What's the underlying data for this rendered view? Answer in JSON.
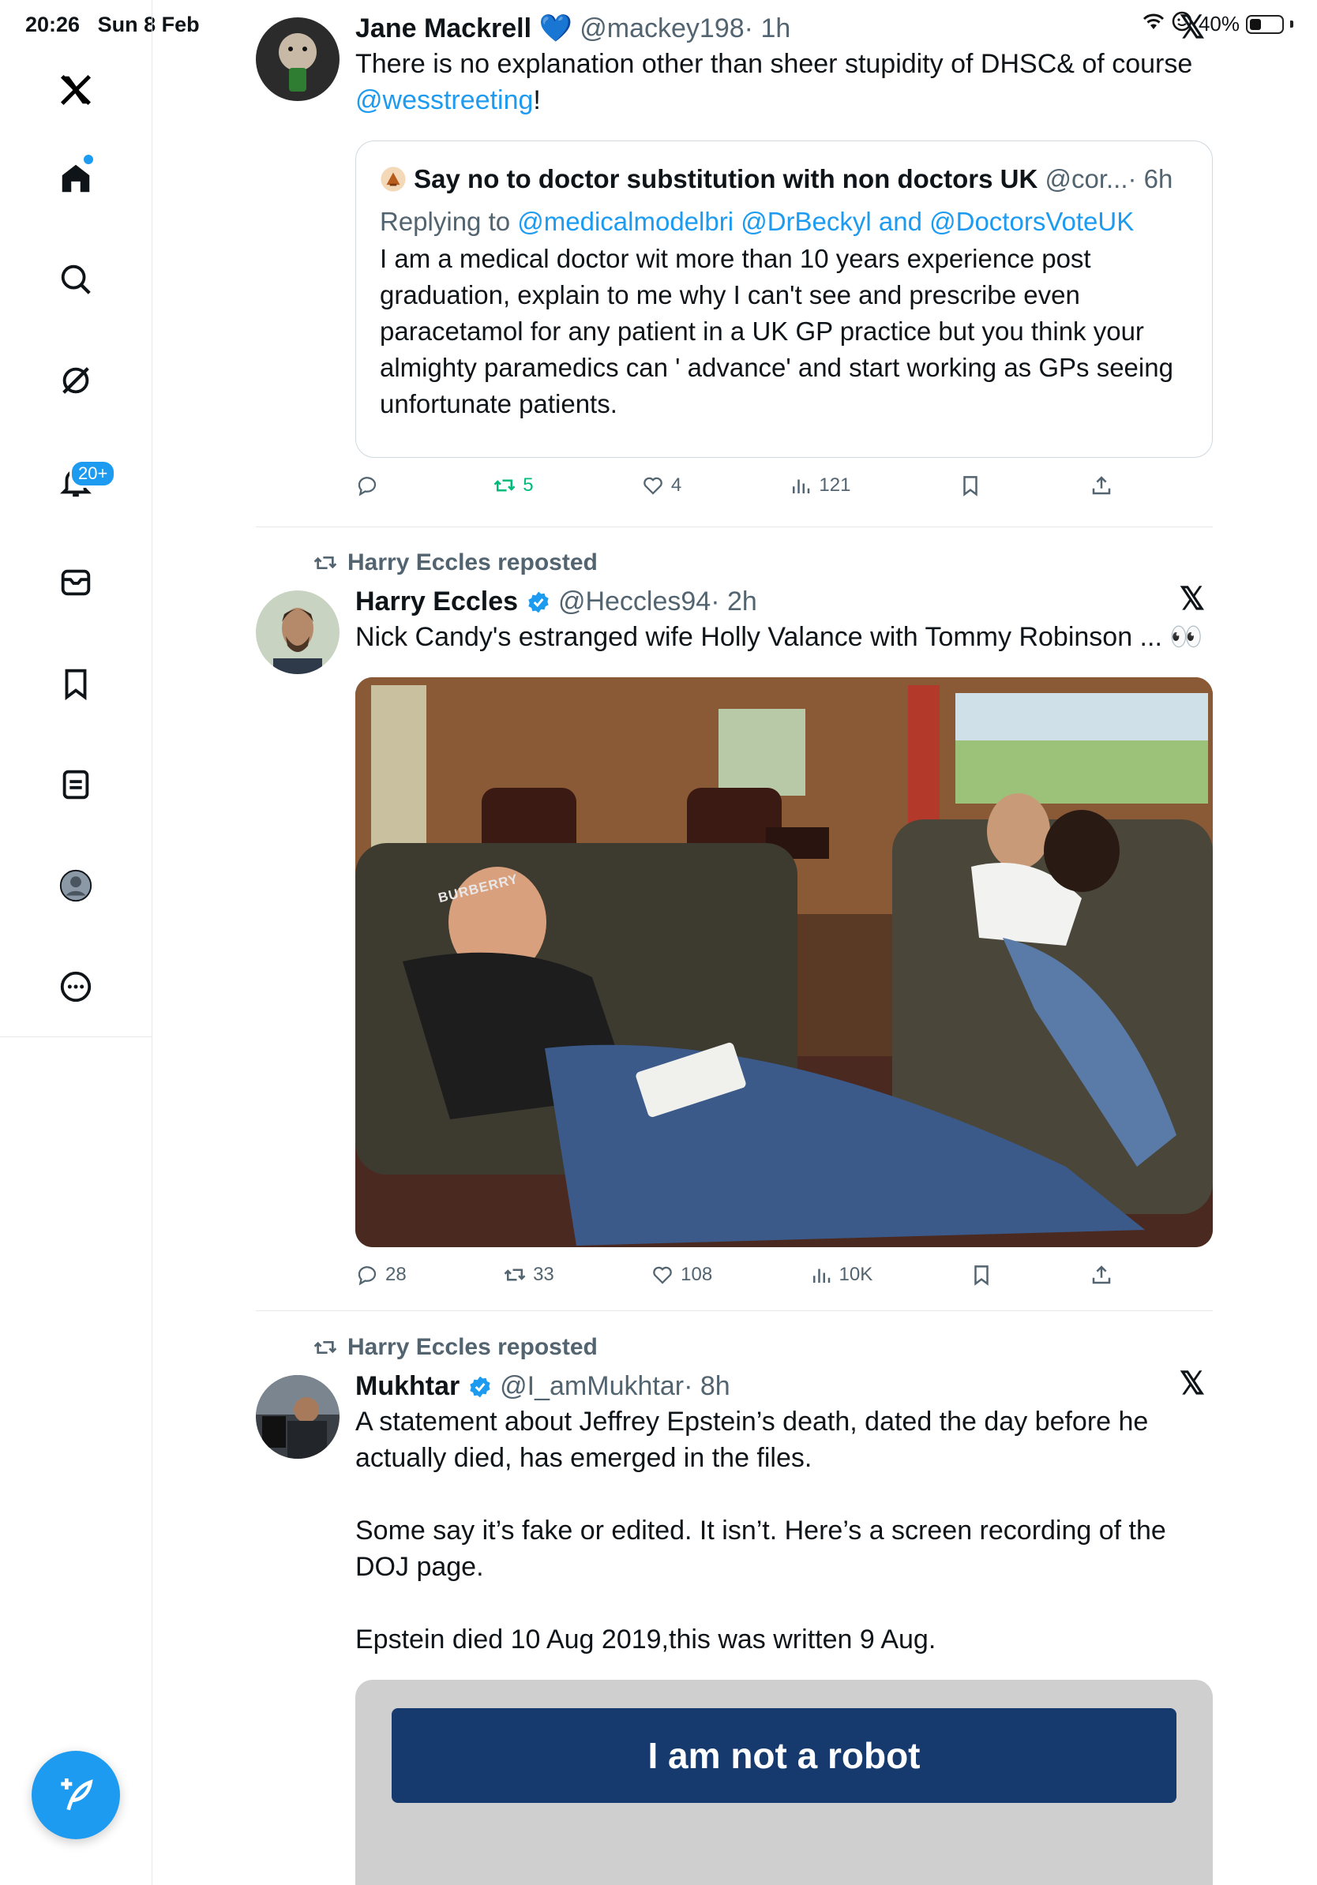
{
  "status_bar": {
    "time": "20:26",
    "date": "Sun 8 Feb",
    "battery": "40%"
  },
  "sidebar": {
    "notification_badge": "20+"
  },
  "tweets": [
    {
      "author": "Jane Mackrell",
      "heart_emoji": "💙",
      "handle": "@mackey198",
      "time": "· 1h",
      "text_before": "There is no explanation other than sheer stupidity of DHSC& of course ",
      "mention": "@wesstreeting",
      "text_after": "!",
      "quote": {
        "author": "Say no to doctor substitution with non doctors UK",
        "handle": "@cor...",
        "time": "· 6h",
        "replying_label": "Replying to ",
        "replying_1": "@medicalmodelbri",
        "replying_2": "@DrBeckyl",
        "replying_and": " and ",
        "replying_3": "@DoctorsVoteUK",
        "text": "I am a medical doctor wit more than 10 years experience post graduation, explain to me why I can't  see and prescribe even paracetamol for any patient in a UK GP practice but you think your almighty paramedics can ' advance' and start working as GPs seeing unfortunate patients."
      },
      "replies": "",
      "reposts": "5",
      "likes": "4",
      "views": "121"
    },
    {
      "repost_label": "Harry Eccles reposted",
      "author": "Harry Eccles",
      "handle": "@Heccles94",
      "time": "· 2h",
      "text": "Nick Candy's estranged wife Holly Valance with Tommy Robinson ... 👀",
      "image_text": "BURBERRY",
      "replies": "28",
      "reposts": "33",
      "likes": "108",
      "views": "10K"
    },
    {
      "repost_label": "Harry Eccles reposted",
      "author": "Mukhtar",
      "handle": "@I_amMukhtar",
      "time": "· 8h",
      "p1": "A statement about Jeffrey Epstein’s death, dated the day before he actually died, has emerged in the files.",
      "p2": "Some say it’s fake or edited. It isn’t. Here’s a screen recording of the DOJ page.",
      "p3": "Epstein died 10 Aug 2019,this was written 9 Aug.",
      "media_button": "I am not a robot"
    }
  ],
  "colors": {
    "accent": "#1d9bf0",
    "repost_green": "#00ba7c",
    "secondary_text": "#536471"
  }
}
